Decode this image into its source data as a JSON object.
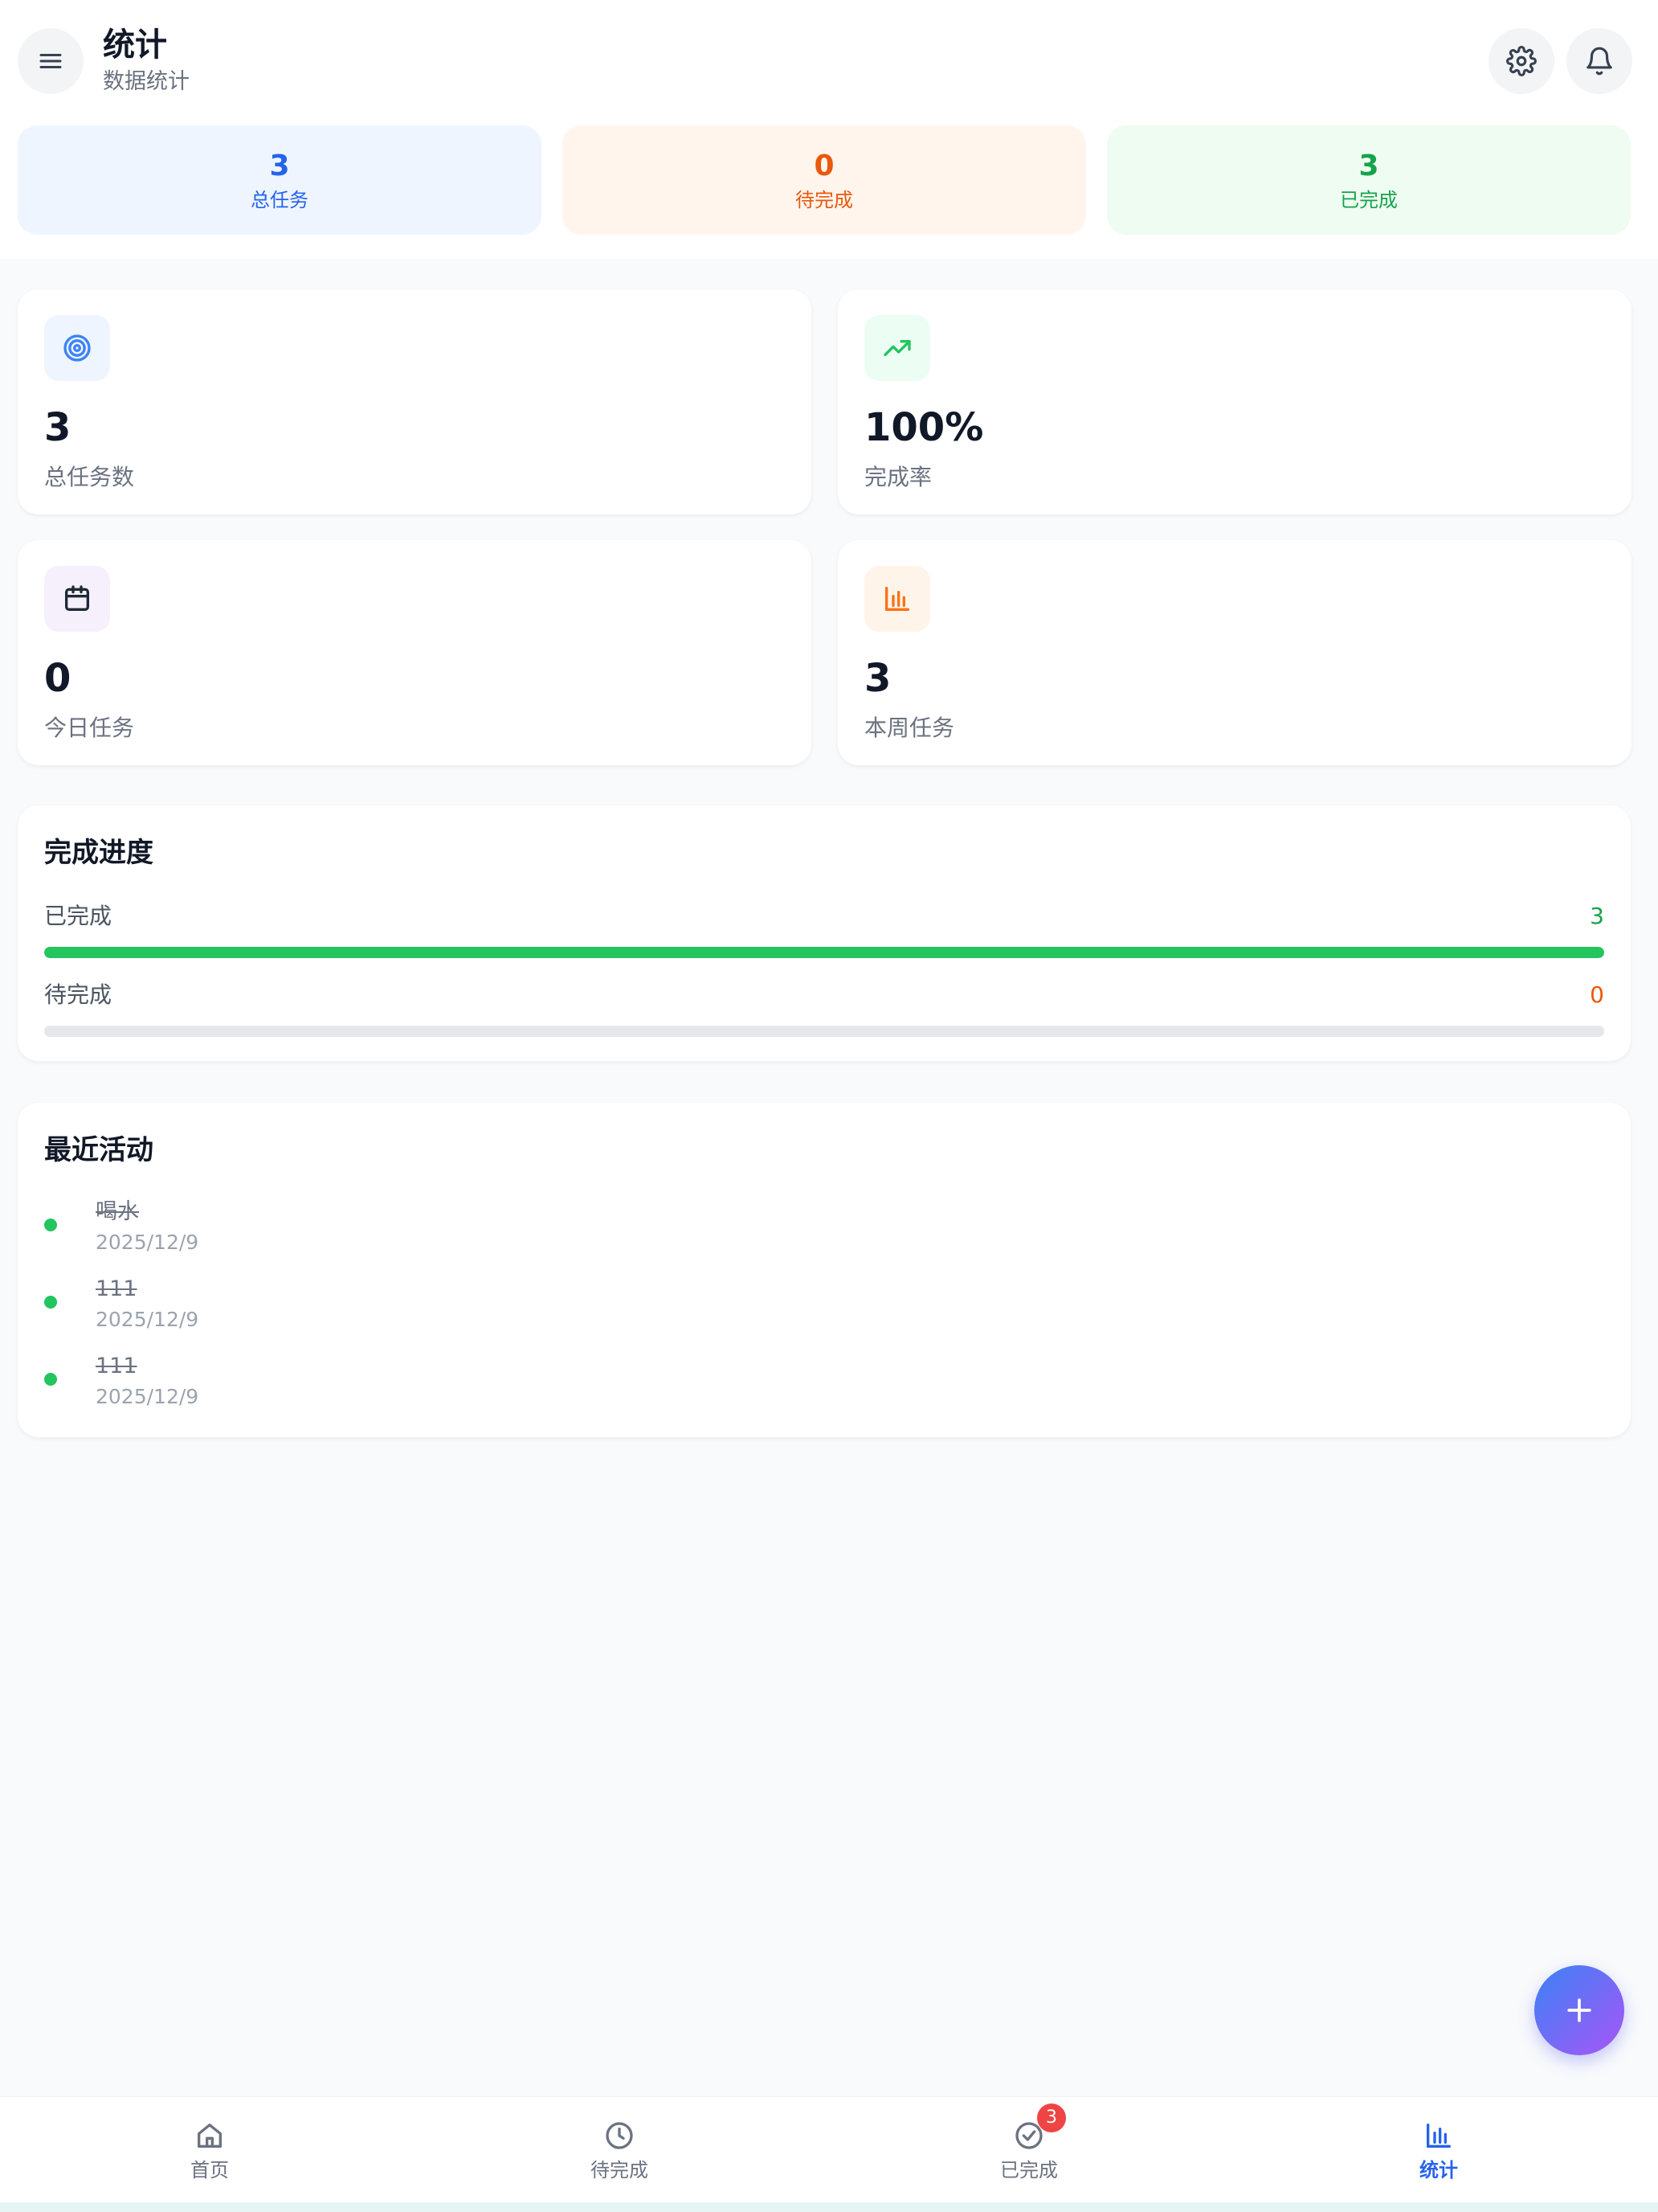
{
  "header": {
    "title": "统计",
    "subtitle": "数据统计",
    "menu_icon": "hamburger-menu-icon",
    "settings_icon": "gear-icon",
    "notification_icon": "bell-icon"
  },
  "summary": [
    {
      "value": "3",
      "label": "总任务",
      "color": "#2563eb",
      "bg": "#eef5ff"
    },
    {
      "value": "0",
      "label": "待完成",
      "color": "#ea580c",
      "bg": "#fff5ec"
    },
    {
      "value": "3",
      "label": "已完成",
      "color": "#16a34a",
      "bg": "#effcf1"
    }
  ],
  "stats": [
    {
      "value": "3",
      "label": "总任务数",
      "icon": "target-icon"
    },
    {
      "value": "100%",
      "label": "完成率",
      "icon": "trending-up-icon"
    },
    {
      "value": "0",
      "label": "今日任务",
      "icon": "calendar-icon"
    },
    {
      "value": "3",
      "label": "本周任务",
      "icon": "bar-chart-icon"
    }
  ],
  "progress": {
    "title": "完成进度",
    "rows": [
      {
        "label": "已完成",
        "count": "3",
        "fraction": 1.0,
        "color": "#22c55e",
        "count_color": "#16a34a"
      },
      {
        "label": "待完成",
        "count": "0",
        "fraction": 0.0,
        "color": "#f97316",
        "count_color": "#ea580c"
      }
    ]
  },
  "activity": {
    "title": "最近活动",
    "items": [
      {
        "title": "喝水",
        "date": "2025/12/9"
      },
      {
        "title": "111",
        "date": "2025/12/9"
      },
      {
        "title": "111",
        "date": "2025/12/9"
      }
    ]
  },
  "fab": {
    "icon": "plus-icon"
  },
  "nav": {
    "items": [
      {
        "label": "首页",
        "icon": "home-icon",
        "active": false
      },
      {
        "label": "待完成",
        "icon": "clock-icon",
        "active": false
      },
      {
        "label": "已完成",
        "icon": "check-circle-icon",
        "active": false,
        "badge": "3"
      },
      {
        "label": "统计",
        "icon": "bar-chart-icon",
        "active": true
      }
    ],
    "active_color": "#2563eb",
    "inactive_color": "#6b7280"
  }
}
